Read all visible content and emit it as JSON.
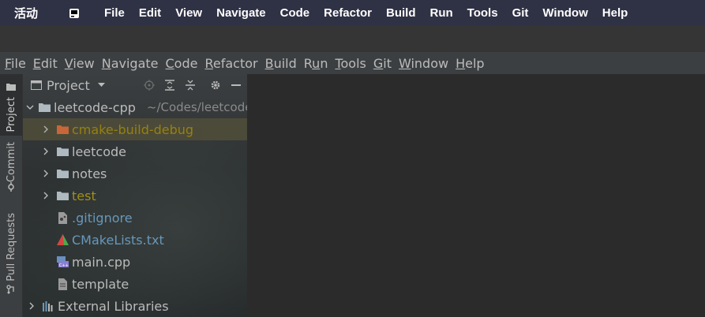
{
  "top_bar": {
    "activities": "活动",
    "menu": [
      "File",
      "Edit",
      "View",
      "Navigate",
      "Code",
      "Refactor",
      "Build",
      "Run",
      "Tools",
      "Git",
      "Window",
      "Help"
    ]
  },
  "menu_bar": {
    "items": [
      {
        "u": "F",
        "rest": "ile"
      },
      {
        "u": "E",
        "rest": "dit"
      },
      {
        "u": "V",
        "rest": "iew"
      },
      {
        "u": "N",
        "rest": "avigate"
      },
      {
        "u": "C",
        "rest": "ode"
      },
      {
        "u": "R",
        "rest": "efactor"
      },
      {
        "u": "B",
        "rest": "uild"
      },
      {
        "pre": "R",
        "u": "u",
        "rest": "n"
      },
      {
        "u": "T",
        "rest": "ools"
      },
      {
        "u": "G",
        "rest": "it"
      },
      {
        "u": "W",
        "rest": "indow"
      },
      {
        "u": "H",
        "rest": "elp"
      }
    ]
  },
  "side_tabs": [
    "Project",
    "Commit",
    "Pull Requests"
  ],
  "panel": {
    "title": "Project",
    "header_icons": [
      "locate-icon",
      "expand-all-icon",
      "collapse-all-icon",
      "gear-icon",
      "hide-icon"
    ]
  },
  "tree": {
    "root": {
      "name": "leetcode-cpp",
      "path": "~/Codes/leetcode-cpp"
    },
    "items": [
      {
        "name": "cmake-build-debug",
        "icon": "folder-excluded-icon",
        "color": "#9e880d",
        "expandable": true,
        "selected": true
      },
      {
        "name": "leetcode",
        "icon": "folder-icon",
        "color": "#bbbbbb",
        "expandable": true
      },
      {
        "name": "notes",
        "icon": "folder-icon",
        "color": "#bbbbbb",
        "expandable": true
      },
      {
        "name": "test",
        "icon": "folder-icon",
        "color": "#a08f1c",
        "expandable": true
      },
      {
        "name": ".gitignore",
        "icon": "gitignore-file-icon",
        "color": "#6897bb",
        "expandable": false
      },
      {
        "name": "CMakeLists.txt",
        "icon": "cmake-file-icon",
        "color": "#6897bb",
        "expandable": false
      },
      {
        "name": "main.cpp",
        "icon": "cpp-file-icon",
        "color": "#bbbbbb",
        "expandable": false
      },
      {
        "name": "template",
        "icon": "text-file-icon",
        "color": "#bbbbbb",
        "expandable": false
      }
    ],
    "external": {
      "name": "External Libraries",
      "icon": "libraries-icon"
    }
  },
  "colors": {
    "folder": "#aeb9c0",
    "excluded_folder": "#d46b3a",
    "selection": "#4e4c3a"
  }
}
